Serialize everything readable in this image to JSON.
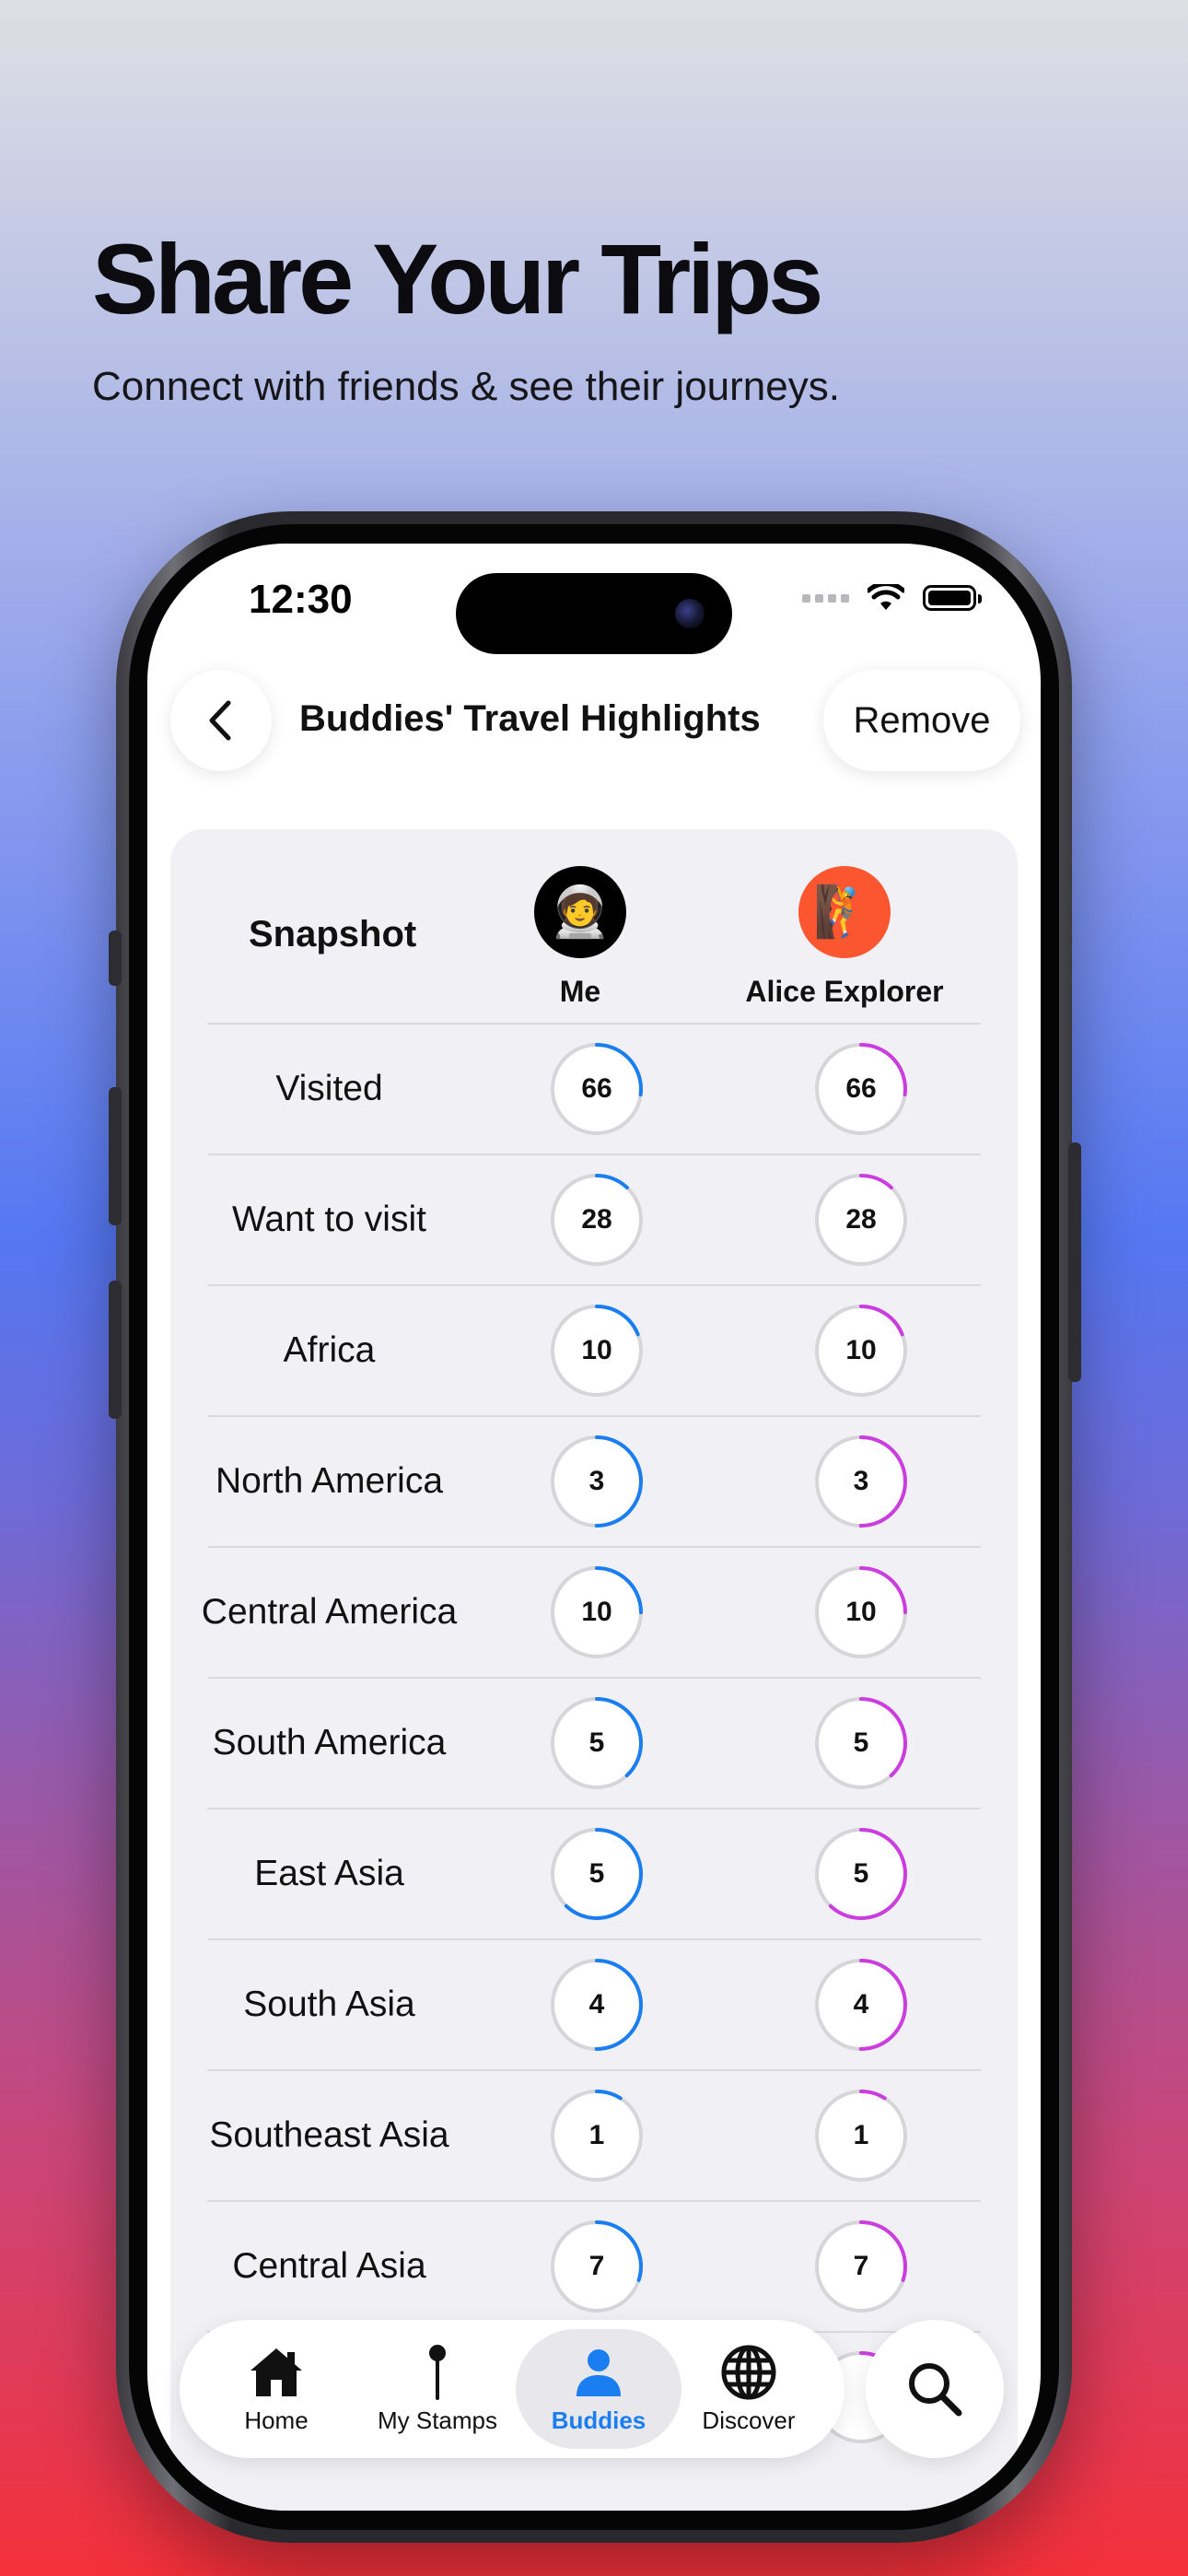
{
  "promo": {
    "headline": "Share Your Trips",
    "subline": "Connect with friends & see their journeys."
  },
  "status_bar": {
    "time": "12:30"
  },
  "nav": {
    "title": "Buddies' Travel Highlights",
    "back_icon": "chevron-left-icon",
    "remove_label": "Remove"
  },
  "table": {
    "header_label": "Snapshot",
    "columns": [
      {
        "name": "Me",
        "avatar_emoji": "🧑‍🚀",
        "avatar_bg": "#000000",
        "ring_color": "#1a7ef0"
      },
      {
        "name": "Alice Explorer",
        "avatar_emoji": "🧗",
        "avatar_bg": "#fb5630",
        "ring_color": "#cc3de0"
      }
    ],
    "rows": [
      {
        "label": "Visited",
        "me": "66",
        "alice": "66",
        "fraction": 0.27
      },
      {
        "label": "Want to visit",
        "me": "28",
        "alice": "28",
        "fraction": 0.12
      },
      {
        "label": "Africa",
        "me": "10",
        "alice": "10",
        "fraction": 0.19
      },
      {
        "label": "North America",
        "me": "3",
        "alice": "3",
        "fraction": 0.5
      },
      {
        "label": "Central America",
        "me": "10",
        "alice": "10",
        "fraction": 0.25
      },
      {
        "label": "South America",
        "me": "5",
        "alice": "5",
        "fraction": 0.38
      },
      {
        "label": "East Asia",
        "me": "5",
        "alice": "5",
        "fraction": 0.62
      },
      {
        "label": "South Asia",
        "me": "4",
        "alice": "4",
        "fraction": 0.5
      },
      {
        "label": "Southeast Asia",
        "me": "1",
        "alice": "1",
        "fraction": 0.09
      },
      {
        "label": "Central Asia",
        "me": "7",
        "alice": "7",
        "fraction": 0.3
      },
      {
        "label": "",
        "me": "",
        "alice": "",
        "fraction": 0.1
      }
    ]
  },
  "tabbar": {
    "tabs": [
      {
        "label": "Home",
        "icon": "house-icon",
        "active": false
      },
      {
        "label": "My Stamps",
        "icon": "map-pin-icon",
        "active": false
      },
      {
        "label": "Buddies",
        "icon": "person-icon",
        "active": true
      },
      {
        "label": "Discover",
        "icon": "globe-icon",
        "active": false
      }
    ],
    "search_icon": "search-icon"
  },
  "colors": {
    "accent_blue": "#1a7ef0",
    "accent_purple": "#cc3de0",
    "ring_track": "#d6d6da"
  }
}
